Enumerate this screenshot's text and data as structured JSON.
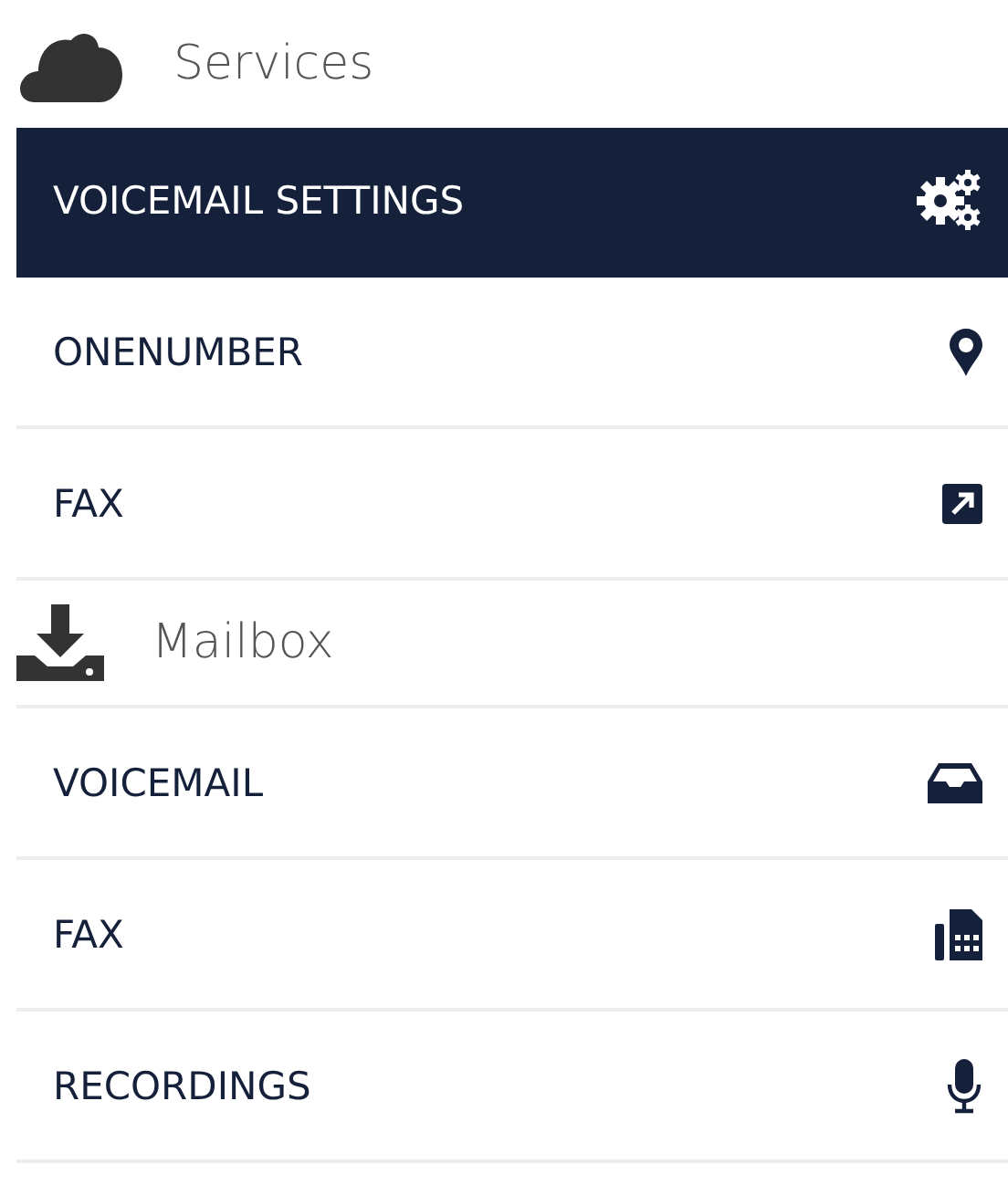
{
  "sections": [
    {
      "title": "Services",
      "items": [
        {
          "label": "VOICEMAIL SETTINGS",
          "selected": true
        },
        {
          "label": "ONENUMBER",
          "selected": false
        },
        {
          "label": "FAX",
          "selected": false
        }
      ]
    },
    {
      "title": "Mailbox",
      "items": [
        {
          "label": "VOICEMAIL",
          "selected": false
        },
        {
          "label": "FAX",
          "selected": false
        },
        {
          "label": "RECORDINGS",
          "selected": false
        }
      ]
    }
  ]
}
